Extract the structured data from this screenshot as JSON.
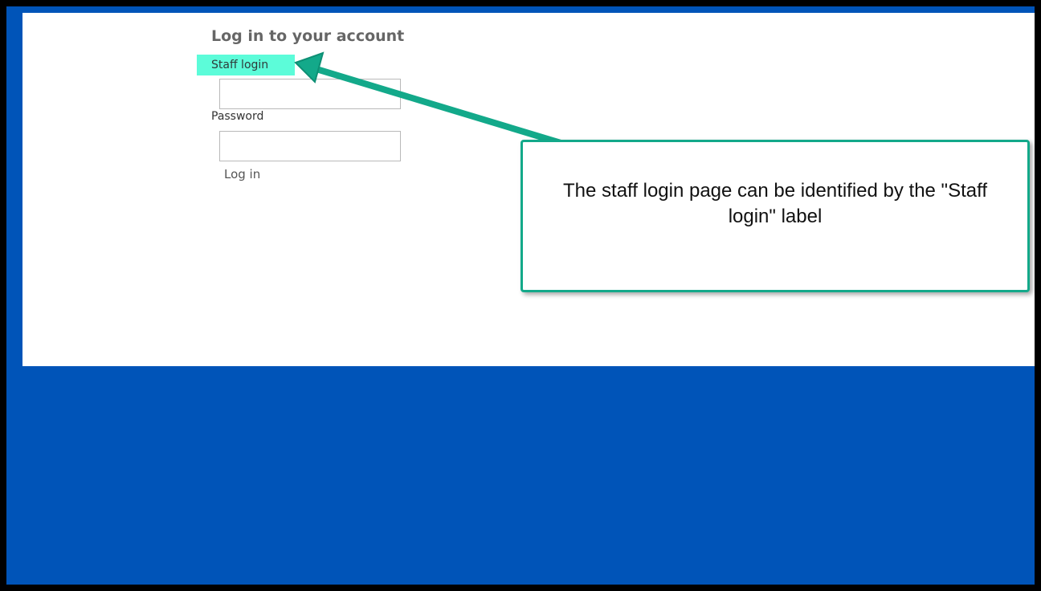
{
  "login": {
    "title": "Log in to your account",
    "staff_label": "Staff login",
    "username_value": "",
    "password_label": "Password",
    "password_value": "",
    "login_button": "Log in"
  },
  "callout": {
    "text": "The staff login page can be identified by the \"Staff login\" label",
    "border_color": "#13a98a",
    "highlight_color": "#5cfcd9"
  },
  "colors": {
    "background_blue": "#0054b8",
    "frame_black": "#000000"
  }
}
